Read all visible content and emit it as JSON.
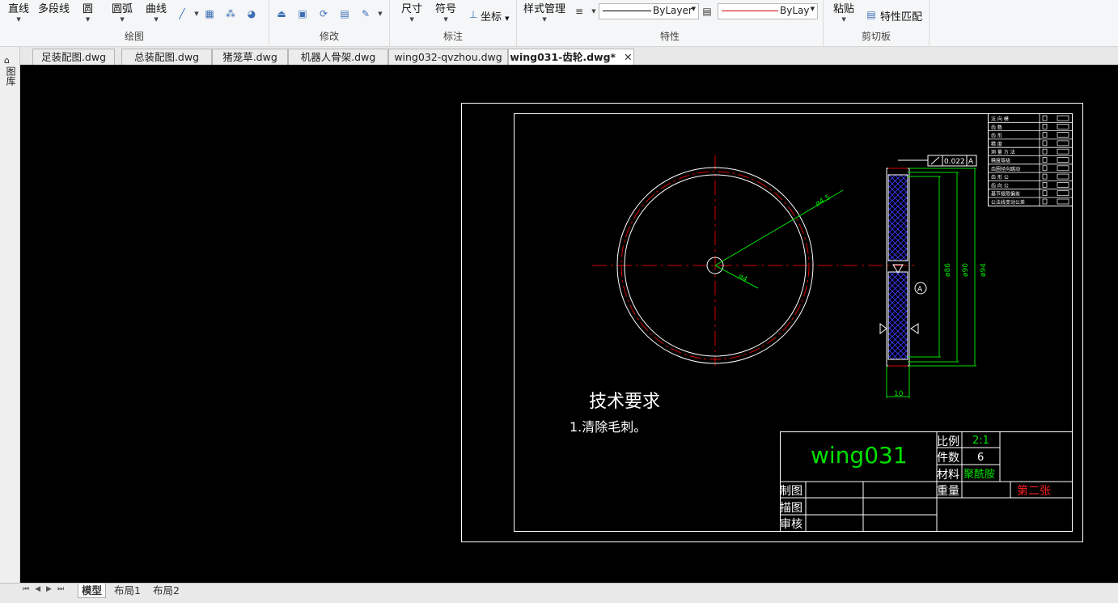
{
  "ribbon": {
    "draw": {
      "line": "直线",
      "polyline": "多段线",
      "circle": "圆",
      "arc": "圆弧",
      "curve": "曲线",
      "group_label": "绘图"
    },
    "modify": {
      "group_label": "修改"
    },
    "annotate": {
      "dimension": "尺寸",
      "symbol": "符号",
      "coordinate": "坐标",
      "group_label": "标注"
    },
    "properties": {
      "style_manager": "样式管理",
      "linetype_value": "ByLayer",
      "color_value": "ByLay",
      "group_label": "特性"
    },
    "clipboard": {
      "paste": "粘贴",
      "match_properties": "特性匹配",
      "group_label": "剪切板"
    }
  },
  "tabs": [
    {
      "label": "足装配图.dwg"
    },
    {
      "label": "总装配图.dwg"
    },
    {
      "label": "猪笼草.dwg"
    },
    {
      "label": "机器人骨架.dwg"
    },
    {
      "label": "wing032-qvzhou.dwg"
    },
    {
      "label": "wing031-齿轮.dwg*",
      "active": true
    }
  ],
  "left_sidebar": {
    "label": "图库"
  },
  "drawing": {
    "tolerance": "0.022",
    "datum": "A",
    "dim_d86": "ø86",
    "dim_d90": "ø90",
    "dim_d94": "ø94",
    "dim_width": "10",
    "dim_leader1": "ø4.5",
    "dim_leader2": "ø4",
    "tech_title": "技术要求",
    "tech_line1": "1.清除毛刺。",
    "title_block": {
      "name": "wing031",
      "scale_label": "比例",
      "scale_value": "2:1",
      "qty_label": "件数",
      "qty_value": "6",
      "material_label": "材料",
      "material_value": "聚酰胺",
      "weight_label": "重量",
      "sheet": "第二张",
      "drawn_label": "制图",
      "traced_label": "描图",
      "checked_label": "审核"
    },
    "tolerance_table": [
      "法 向 模",
      "齿 数",
      "齿 形",
      "精 度",
      "测 量 方 法",
      "精度等级",
      "齿圈径向跳动",
      "齿 形 公",
      "齿 向 公",
      "基节极限偏差",
      "公法线变动公差"
    ]
  },
  "layout_tabs": [
    {
      "label": "模型",
      "active": true
    },
    {
      "label": "布局1"
    },
    {
      "label": "布局2"
    }
  ],
  "colors": {
    "canvas_bg": "#000000",
    "center_line": "#d40000",
    "dimension": "#00e000",
    "outline": "#ffffff",
    "hatch": "#2a2af0",
    "sheet_text": "#ff2020"
  }
}
